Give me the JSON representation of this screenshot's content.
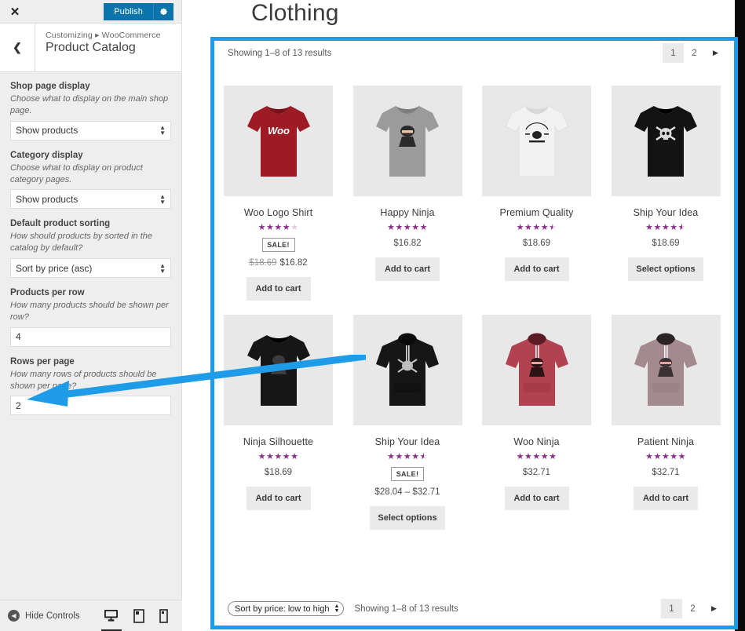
{
  "customizer": {
    "close_label": "✕",
    "publish_label": "Publish",
    "gear_icon": "gear-icon",
    "back_icon": "chevron-left-icon",
    "breadcrumb": "Customizing ▸ WooCommerce",
    "panel_title": "Product Catalog",
    "controls": [
      {
        "label": "Shop page display",
        "description": "Choose what to display on the main shop page.",
        "type": "select",
        "value": "Show products"
      },
      {
        "label": "Category display",
        "description": "Choose what to display on product category pages.",
        "type": "select",
        "value": "Show products"
      },
      {
        "label": "Default product sorting",
        "description": "How should products by sorted in the catalog by default?",
        "type": "select",
        "value": "Sort by price (asc)"
      },
      {
        "label": "Products per row",
        "description": "How many products should be shown per row?",
        "type": "number",
        "value": "4"
      },
      {
        "label": "Rows per page",
        "description": "How many rows of products should be shown per page?",
        "type": "number",
        "value": "2"
      }
    ],
    "footer": {
      "hide_controls_label": "Hide Controls",
      "devices": [
        "desktop-icon",
        "tablet-icon",
        "mobile-icon"
      ],
      "active_device": "desktop-icon"
    }
  },
  "preview": {
    "category_title": "Clothing",
    "results_top": "Showing 1–8 of 13 results",
    "results_bottom": "Showing 1–8 of 13 results",
    "sort_value": "Sort by price: low to high",
    "pagination": {
      "pages": [
        "1",
        "2"
      ],
      "active": "1",
      "next_icon": "next-arrow-icon"
    },
    "products": [
      {
        "name": "Woo Logo Shirt",
        "rating": 4,
        "sale": true,
        "sale_label": "SALE!",
        "old_price": "$18.69",
        "price": "$16.82",
        "cta": "Add to cart",
        "image": "red-tshirt-woo-logo"
      },
      {
        "name": "Happy Ninja",
        "rating": 5,
        "sale": false,
        "sale_label": "",
        "old_price": "",
        "price": "$16.82",
        "cta": "Add to cart",
        "image": "gray-tshirt-ninja"
      },
      {
        "name": "Premium Quality",
        "rating": 4.5,
        "sale": false,
        "sale_label": "",
        "old_price": "",
        "price": "$18.69",
        "cta": "Add to cart",
        "image": "white-tshirt-woothemes"
      },
      {
        "name": "Ship Your Idea",
        "rating": 4.5,
        "sale": false,
        "sale_label": "",
        "old_price": "",
        "price": "$18.69",
        "cta": "Select options",
        "image": "black-tshirt-skull"
      },
      {
        "name": "Ninja Silhouette",
        "rating": 5,
        "sale": false,
        "sale_label": "",
        "old_price": "",
        "price": "$18.69",
        "cta": "Add to cart",
        "image": "black-tshirt-ninja"
      },
      {
        "name": "Ship Your Idea",
        "rating": 4.5,
        "sale": true,
        "sale_label": "SALE!",
        "old_price": "",
        "price": "$28.04 – $32.71",
        "cta": "Select options",
        "image": "black-hoodie-skull"
      },
      {
        "name": "Woo Ninja",
        "rating": 5,
        "sale": false,
        "sale_label": "",
        "old_price": "",
        "price": "$32.71",
        "cta": "Add to cart",
        "image": "red-hoodie-ninja"
      },
      {
        "name": "Patient Ninja",
        "rating": 5,
        "sale": false,
        "sale_label": "",
        "old_price": "",
        "price": "$32.71",
        "cta": "Add to cart",
        "image": "mauve-hoodie-ninja"
      }
    ]
  },
  "annotation": {
    "color": "#1f9ce8",
    "target": "rows-per-page-field"
  }
}
